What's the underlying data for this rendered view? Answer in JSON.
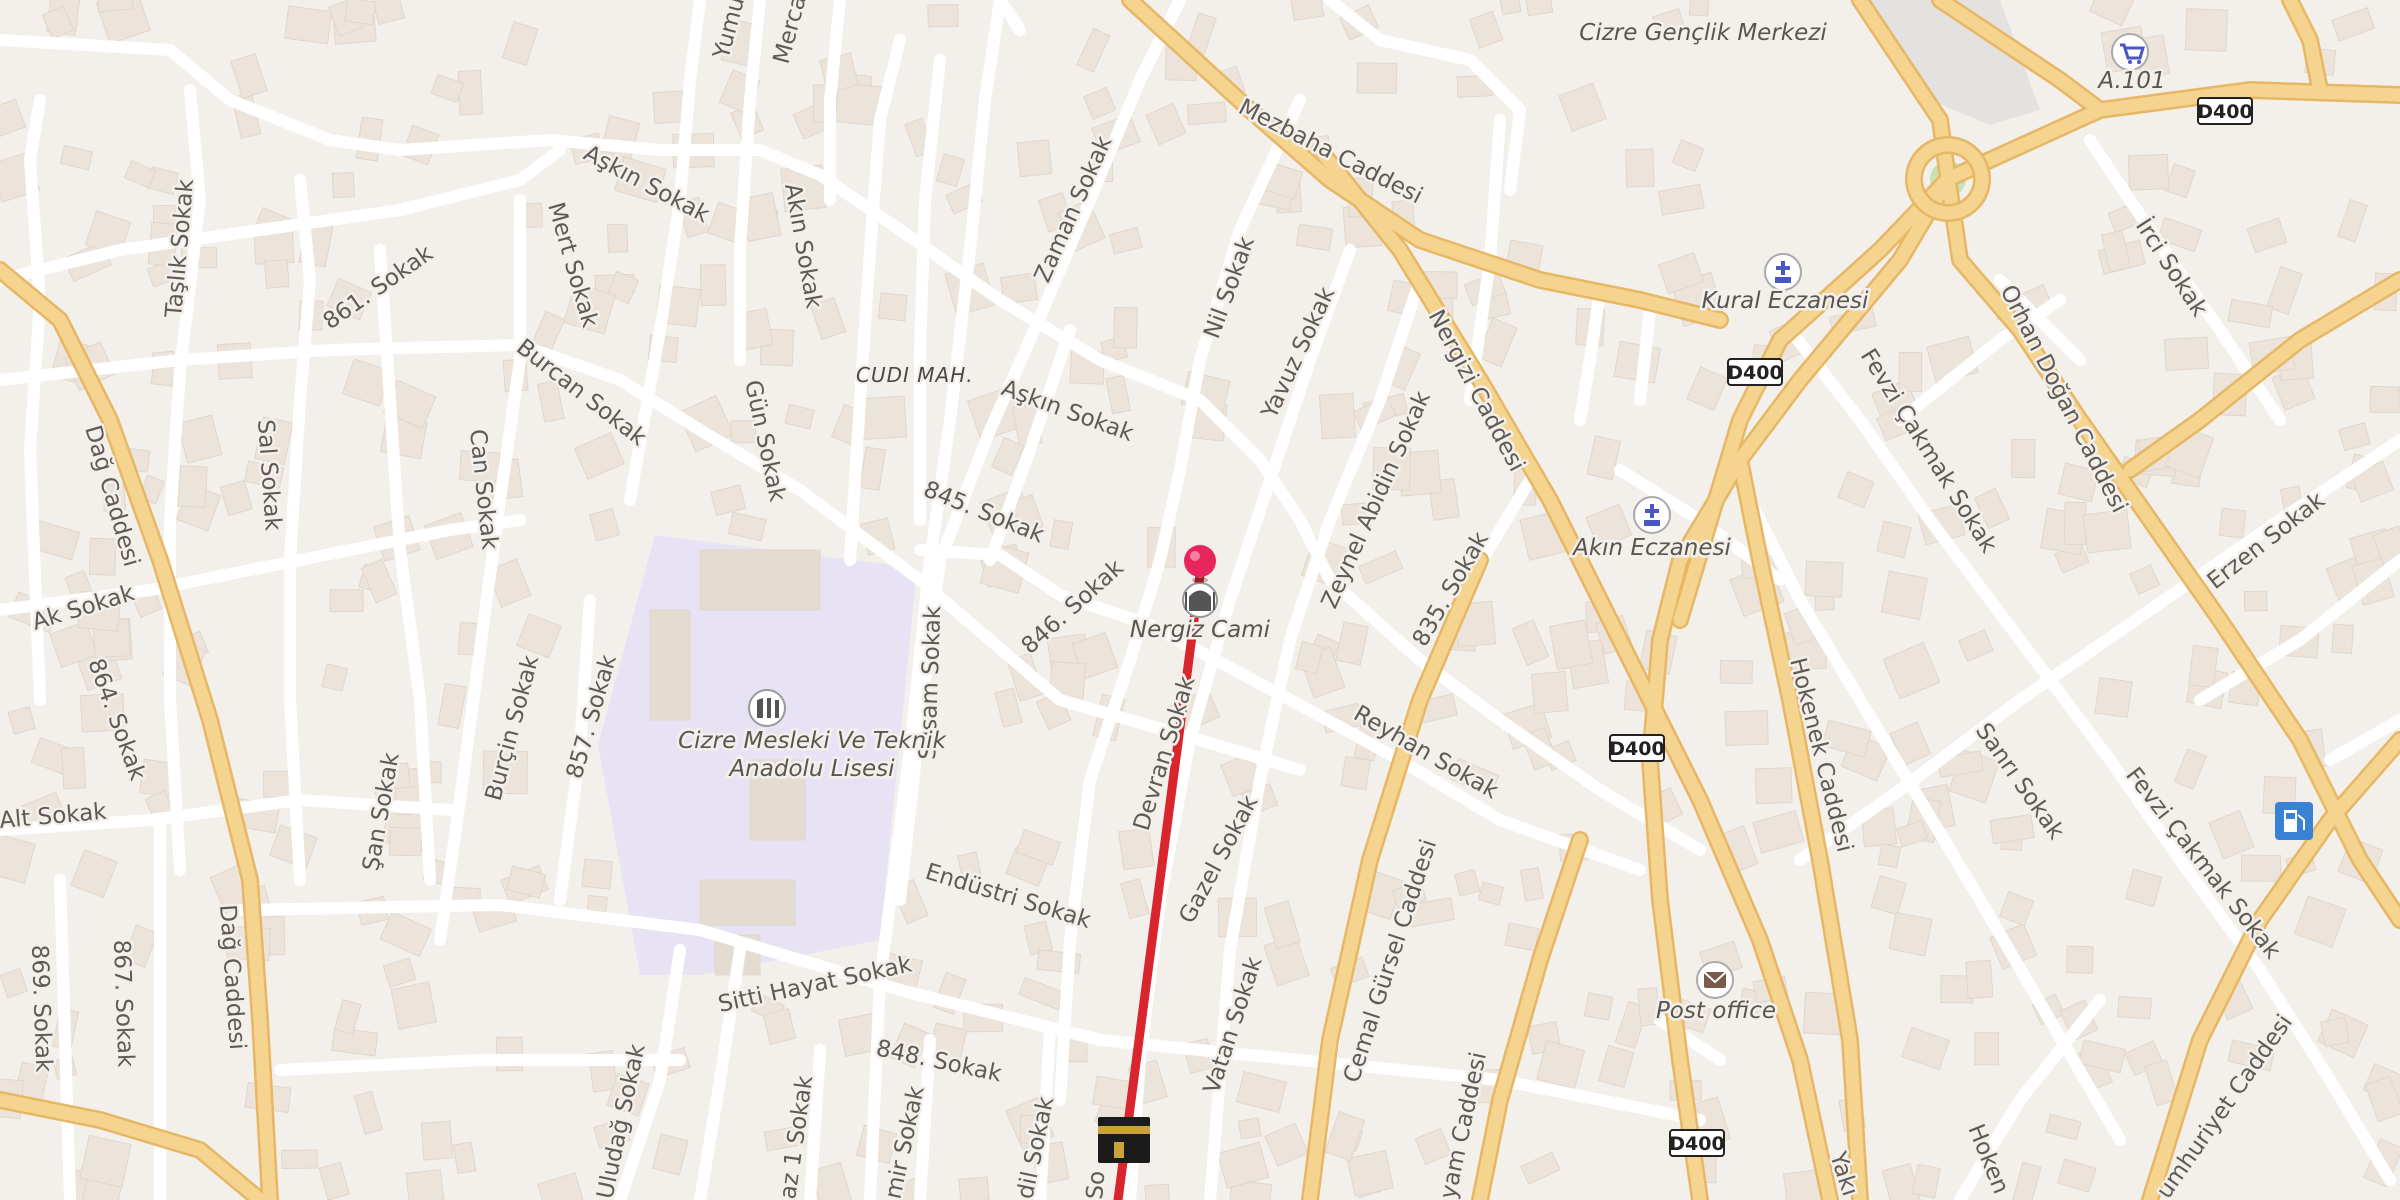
{
  "area_label": "CUDI MAH.",
  "streets": [
    {
      "id": "mezbaha",
      "label": "Mezbaha Caddesi"
    },
    {
      "id": "askin1",
      "label": "Aşkın Sokak"
    },
    {
      "id": "askin2",
      "label": "Aşkın Sokak"
    },
    {
      "id": "yumu",
      "label": "Yumu"
    },
    {
      "id": "merca",
      "label": "Merca"
    },
    {
      "id": "akin",
      "label": "Akın Sokak"
    },
    {
      "id": "zaman",
      "label": "Zaman Sokak"
    },
    {
      "id": "mert",
      "label": "Mert Sokak"
    },
    {
      "id": "tasli",
      "label": "Taşlık Sokak"
    },
    {
      "id": "s861",
      "label": "861. Sokak"
    },
    {
      "id": "nil",
      "label": "Nil Sokak"
    },
    {
      "id": "yavuz",
      "label": "Yavuz Sokak"
    },
    {
      "id": "nergizi",
      "label": "Nergizi Caddesi"
    },
    {
      "id": "burcan",
      "label": "Burcan Sokak"
    },
    {
      "id": "gun",
      "label": "Gün Sokak"
    },
    {
      "id": "sal",
      "label": "Sal Sokak"
    },
    {
      "id": "can",
      "label": "Can Sokak"
    },
    {
      "id": "dag1",
      "label": "Dağ Caddesi"
    },
    {
      "id": "dag2",
      "label": "Dağ Caddesi"
    },
    {
      "id": "s845",
      "label": "845. Sokak"
    },
    {
      "id": "s846",
      "label": "846. Sokak"
    },
    {
      "id": "zeynel",
      "label": "Zeynel Abidin Sokak"
    },
    {
      "id": "s835",
      "label": "835. Sokak"
    },
    {
      "id": "ak",
      "label": "Ak Sokak"
    },
    {
      "id": "s864",
      "label": "864. Sokak"
    },
    {
      "id": "burcin",
      "label": "Burçin Sokak"
    },
    {
      "id": "s857",
      "label": "857. Sokak"
    },
    {
      "id": "susam",
      "label": "Susam Sokak"
    },
    {
      "id": "devran",
      "label": "Devran Sokak"
    },
    {
      "id": "reyhan",
      "label": "Reyhan Sokak"
    },
    {
      "id": "alt",
      "label": "Alt Sokak"
    },
    {
      "id": "san",
      "label": "Şan Sokak"
    },
    {
      "id": "endustri",
      "label": "Endüstri Sokak"
    },
    {
      "id": "gazel",
      "label": "Gazel Sokak"
    },
    {
      "id": "cemal",
      "label": "Cemal Gürsel Caddesi"
    },
    {
      "id": "hokenek1",
      "label": "Hokenek Caddesi"
    },
    {
      "id": "fevzi1",
      "label": "Fevzi Çakmak Sokak"
    },
    {
      "id": "fevzi2",
      "label": "Fevzi Çakmak Sokak"
    },
    {
      "id": "orhan",
      "label": "Orhan Doğan Caddesi"
    },
    {
      "id": "irci",
      "label": "İrci Sokak"
    },
    {
      "id": "erzen",
      "label": "Erzen Sokak"
    },
    {
      "id": "sanri",
      "label": "Sanrı Sokak"
    },
    {
      "id": "sitti",
      "label": "Sitti Hayat Sokak"
    },
    {
      "id": "s848",
      "label": "848. Sokak"
    },
    {
      "id": "vatan",
      "label": "Vatan Sokak"
    },
    {
      "id": "s869",
      "label": "869. Sokak"
    },
    {
      "id": "s867",
      "label": "867. Sokak"
    },
    {
      "id": "uludag",
      "label": "Uludağ Sokak"
    },
    {
      "id": "az1",
      "label": "az 1 Sokak"
    },
    {
      "id": "mir",
      "label": "mir Sokak"
    },
    {
      "id": "dil",
      "label": "dil Sokak"
    },
    {
      "id": "so",
      "label": "So"
    },
    {
      "id": "yam",
      "label": "yam Caddesi"
    },
    {
      "id": "yaku",
      "label": "Yakı"
    },
    {
      "id": "hoken2",
      "label": "Hoken"
    },
    {
      "id": "cumhuriyet",
      "label": "umhuriyet Caddesi"
    }
  ],
  "pois": [
    {
      "id": "nergiz",
      "label": "Nergiz Cami",
      "icon": "mosque-icon"
    },
    {
      "id": "lise1",
      "label": "Cizre Mesleki Ve Teknik",
      "icon": "school-icon"
    },
    {
      "id": "lise2",
      "label": "Anadolu Lisesi"
    },
    {
      "id": "genclik",
      "label": "Cizre Gençlik Merkezi"
    },
    {
      "id": "a101",
      "label": "A.101",
      "icon": "shopping-cart-icon"
    },
    {
      "id": "kural",
      "label": "Kural Eczanesi",
      "icon": "pharmacy-icon"
    },
    {
      "id": "akin_ecz",
      "label": "Akın Eczanesi",
      "icon": "pharmacy-icon"
    },
    {
      "id": "post",
      "label": "Post office",
      "icon": "mail-icon"
    },
    {
      "id": "fuel",
      "label": "",
      "icon": "fuel-station-icon"
    },
    {
      "id": "kaaba",
      "label": "",
      "icon": "kaaba-icon"
    }
  ],
  "road_shields": [
    "D400",
    "D400",
    "D400",
    "D400"
  ],
  "route": {
    "color": "#d9262e",
    "description_visible": false
  },
  "colors": {
    "land": "#f3f0ec",
    "building": "#ece4db",
    "major_road": "#f5d48f",
    "major_road_casing": "#e6b765",
    "minor_road": "#ffffff",
    "school_area": "#e7e3f4",
    "pin": "#e8265e",
    "route": "#d9262e"
  }
}
